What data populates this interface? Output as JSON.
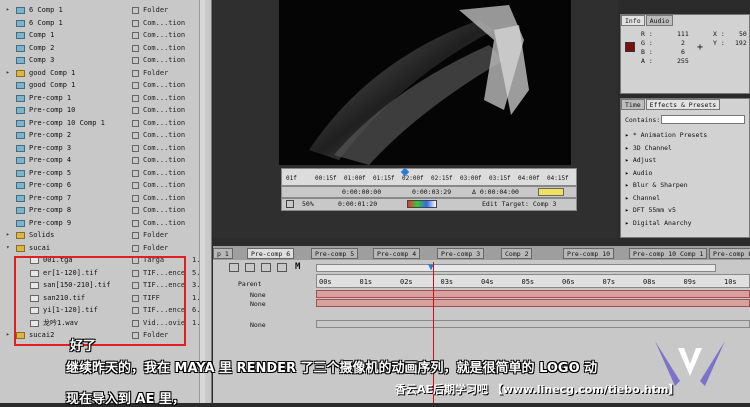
{
  "project": {
    "rows": [
      {
        "indent": 0,
        "tri": "▸",
        "icon": "comp",
        "name": "6 Comp 1",
        "type": "Folder"
      },
      {
        "indent": 0,
        "tri": "",
        "icon": "comp",
        "name": "6 Comp 1",
        "type": "Com...tion"
      },
      {
        "indent": 0,
        "tri": "",
        "icon": "comp",
        "name": "Comp 1",
        "type": "Com...tion"
      },
      {
        "indent": 0,
        "tri": "",
        "icon": "comp",
        "name": "Comp 2",
        "type": "Com...tion"
      },
      {
        "indent": 0,
        "tri": "",
        "icon": "comp",
        "name": "Comp 3",
        "type": "Com...tion"
      },
      {
        "indent": 0,
        "tri": "▸",
        "icon": "folder",
        "name": "good Comp 1",
        "type": "Folder"
      },
      {
        "indent": 0,
        "tri": "",
        "icon": "comp",
        "name": "good Comp 1",
        "type": "Com...tion"
      },
      {
        "indent": 0,
        "tri": "",
        "icon": "comp",
        "name": "Pre-comp 1",
        "type": "Com...tion"
      },
      {
        "indent": 0,
        "tri": "",
        "icon": "comp",
        "name": "Pre-comp 10",
        "type": "Com...tion"
      },
      {
        "indent": 0,
        "tri": "",
        "icon": "comp",
        "name": "Pre-comp 10 Comp 1",
        "type": "Com...tion"
      },
      {
        "indent": 0,
        "tri": "",
        "icon": "comp",
        "name": "Pre-comp 2",
        "type": "Com...tion"
      },
      {
        "indent": 0,
        "tri": "",
        "icon": "comp",
        "name": "Pre-comp 3",
        "type": "Com...tion"
      },
      {
        "indent": 0,
        "tri": "",
        "icon": "comp",
        "name": "Pre-comp 4",
        "type": "Com...tion"
      },
      {
        "indent": 0,
        "tri": "",
        "icon": "comp",
        "name": "Pre-comp 5",
        "type": "Com...tion"
      },
      {
        "indent": 0,
        "tri": "",
        "icon": "comp",
        "name": "Pre-comp 6",
        "type": "Com...tion"
      },
      {
        "indent": 0,
        "tri": "",
        "icon": "comp",
        "name": "Pre-comp 7",
        "type": "Com...tion"
      },
      {
        "indent": 0,
        "tri": "",
        "icon": "comp",
        "name": "Pre-comp 8",
        "type": "Com...tion"
      },
      {
        "indent": 0,
        "tri": "",
        "icon": "comp",
        "name": "Pre-comp 9",
        "type": "Com...tion"
      },
      {
        "indent": 0,
        "tri": "▸",
        "icon": "folder",
        "name": "Solids",
        "type": "Folder"
      },
      {
        "indent": 0,
        "tri": "▾",
        "icon": "folder",
        "name": "sucai",
        "type": "Folder"
      },
      {
        "indent": 1,
        "tri": "",
        "icon": "file",
        "name": "001.tga",
        "type": "Targa",
        "ext": "1."
      },
      {
        "indent": 1,
        "tri": "",
        "icon": "file",
        "name": "er[1-120].tif",
        "type": "TIF...ence",
        "ext": "5."
      },
      {
        "indent": 1,
        "tri": "",
        "icon": "file",
        "name": "san[150-210].tif",
        "type": "TIF...ence",
        "ext": "3."
      },
      {
        "indent": 1,
        "tri": "",
        "icon": "file",
        "name": "san210.tif",
        "type": "TIFF",
        "ext": "1."
      },
      {
        "indent": 1,
        "tri": "",
        "icon": "file",
        "name": "yi[1-120].tif",
        "type": "TIF...ence",
        "ext": "6."
      },
      {
        "indent": 1,
        "tri": "",
        "icon": "file",
        "name": "龙吟1.wav",
        "type": "Vid...ovie",
        "ext": "1."
      },
      {
        "indent": 0,
        "tri": "▸",
        "icon": "folder",
        "name": "sucai2",
        "type": "Folder"
      }
    ]
  },
  "viewer": {
    "ruler_labels": [
      "01f",
      "00:15f",
      "01:00f",
      "01:15f",
      "02:00f",
      "02:15f",
      "03:00f",
      "03:15f",
      "04:00f",
      "04:15f"
    ],
    "time_start": "0:00:00:00",
    "time_end": "0:00:03:29",
    "time_duration": "Δ 0:00:04:00",
    "zoom": "50%",
    "current_time": "0:00:01:20",
    "edit_target": "Edit Target: Comp 3"
  },
  "info": {
    "tabs": [
      "Info",
      "Audio"
    ],
    "r_label": "R :",
    "r": "111",
    "g_label": "G :",
    "g": "2",
    "b_label": "B :",
    "b": "6",
    "a_label": "A :",
    "a": "255",
    "x_label": "X :",
    "x": "50",
    "y_label": "Y :",
    "y": "192",
    "swatch_color": "#7a0f12"
  },
  "effects": {
    "tabs": [
      "Time",
      "Effects & Presets"
    ],
    "contains_label": "Contains:",
    "items": [
      "* Animation Presets",
      "3D Channel",
      "Adjust",
      "Audio",
      "Blur & Sharpen",
      "Channel",
      "DFT 55mm v5",
      "Digital Anarchy"
    ]
  },
  "timeline": {
    "tabs": [
      "p 1",
      "Pre-comp 6",
      "Pre-comp 5",
      "Pre-comp 4",
      "Pre-comp 3",
      "Comp 2",
      "Pre-comp 10",
      "Pre-comp 10 Comp 1",
      "Pre-comp 8"
    ],
    "active_tab": "Pre-comp 6",
    "ruler": [
      "00s",
      "01s",
      "02s",
      "03s",
      "04s",
      "05s",
      "06s",
      "07s",
      "08s",
      "09s",
      "10s"
    ],
    "parent_label": "Parent",
    "parent_values": [
      "None",
      "None",
      "None"
    ],
    "m_button": "M"
  },
  "subtitles": {
    "line1": "好了",
    "line2": "继续昨天的，我在 MAYA 里 RENDER 了三个摄像机的动画序列，就是很简单的 LOGO 动",
    "line3": "现在导入到 AE 里，"
  },
  "watermark": "香云AE后期学习吧 【www.linecg.com/tiebo.htm】"
}
